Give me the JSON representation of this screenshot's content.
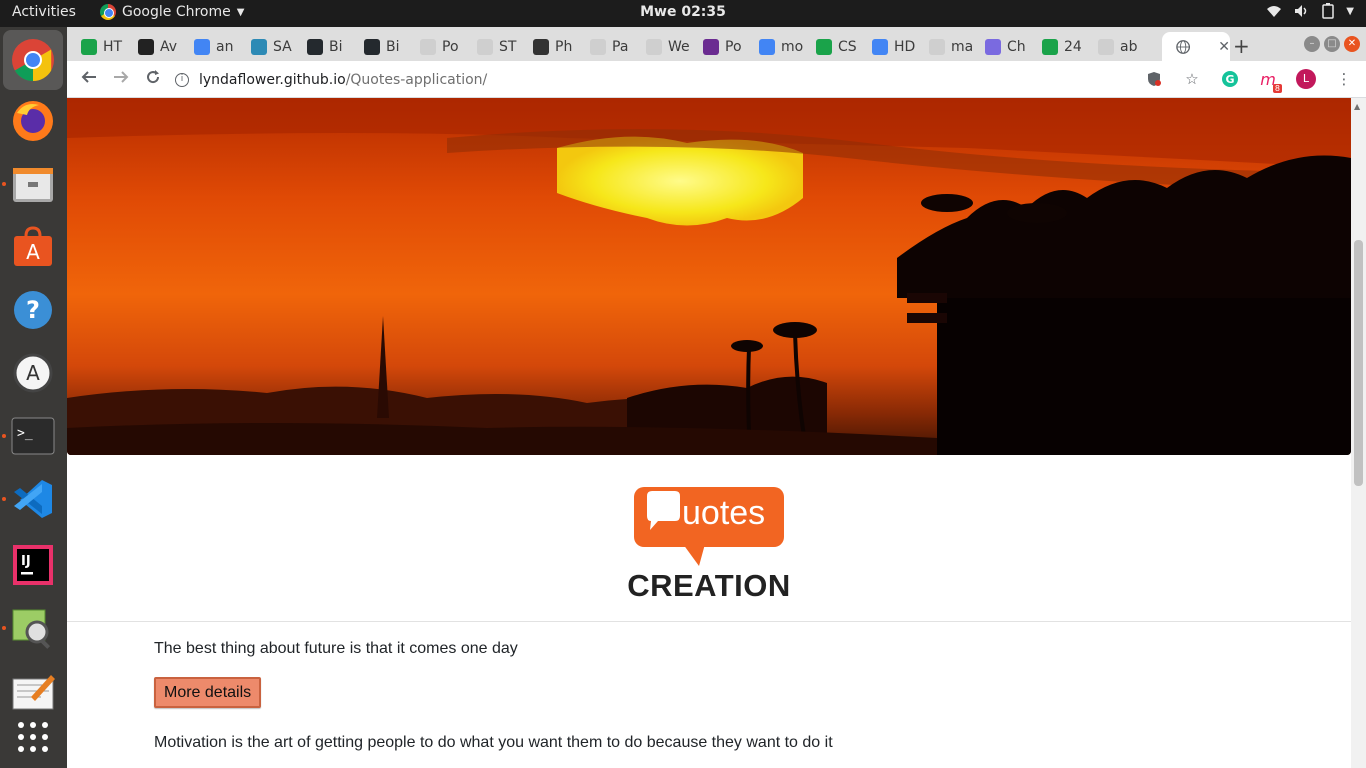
{
  "topbar": {
    "activities": "Activities",
    "app_name": "Google Chrome",
    "clock": "Mwe 02:35"
  },
  "dock": {
    "items": [
      {
        "name": "chrome",
        "running": true,
        "active": true
      },
      {
        "name": "firefox",
        "running": false
      },
      {
        "name": "files",
        "running": true
      },
      {
        "name": "software-center",
        "running": false
      },
      {
        "name": "help",
        "running": false
      },
      {
        "name": "software-updater",
        "running": false
      },
      {
        "name": "terminal",
        "running": true
      },
      {
        "name": "vscode",
        "running": true
      },
      {
        "name": "intellij",
        "running": false
      },
      {
        "name": "image-viewer",
        "running": true
      },
      {
        "name": "text-editor",
        "running": false
      },
      {
        "name": "show-apps",
        "running": false
      }
    ]
  },
  "tabs": [
    {
      "label": "HT",
      "color": "#1aa34a"
    },
    {
      "label": "Av",
      "color": "#222222"
    },
    {
      "label": "an",
      "color": "#4285f4"
    },
    {
      "label": "SA",
      "color": "#2d8ab5"
    },
    {
      "label": "Bi",
      "color": "#24292e"
    },
    {
      "label": "Bi",
      "color": "#24292e"
    },
    {
      "label": "Po",
      "color": "#cfcfcf"
    },
    {
      "label": "ST",
      "color": "#cfcfcf"
    },
    {
      "label": "Ph",
      "color": "#333333"
    },
    {
      "label": "Pa",
      "color": "#cfcfcf"
    },
    {
      "label": "We",
      "color": "#cfcfcf"
    },
    {
      "label": "Po",
      "color": "#6b2c91"
    },
    {
      "label": "mo",
      "color": "#4285f4"
    },
    {
      "label": "CS",
      "color": "#1aa34a"
    },
    {
      "label": "HD",
      "color": "#4285f4"
    },
    {
      "label": "ma",
      "color": "#cfcfcf"
    },
    {
      "label": "Ch",
      "color": "#7a6ae0"
    },
    {
      "label": "24",
      "color": "#1aa34a"
    },
    {
      "label": "ab",
      "color": "#cfcfcf"
    }
  ],
  "active_tab": {
    "label": ""
  },
  "omnibox": {
    "host": "lyndaflower.github.io",
    "path": "/Quotes-application/"
  },
  "toolbar": {
    "profile_initial": "L",
    "extension_badge": "8"
  },
  "page": {
    "logo_text": "uotes",
    "title": "CREATION",
    "quotes": [
      "The best thing about future is that it comes one day",
      "Motivation is the art of getting people to do what you want them to do because they want to do it"
    ],
    "more_details_label": "More details"
  }
}
